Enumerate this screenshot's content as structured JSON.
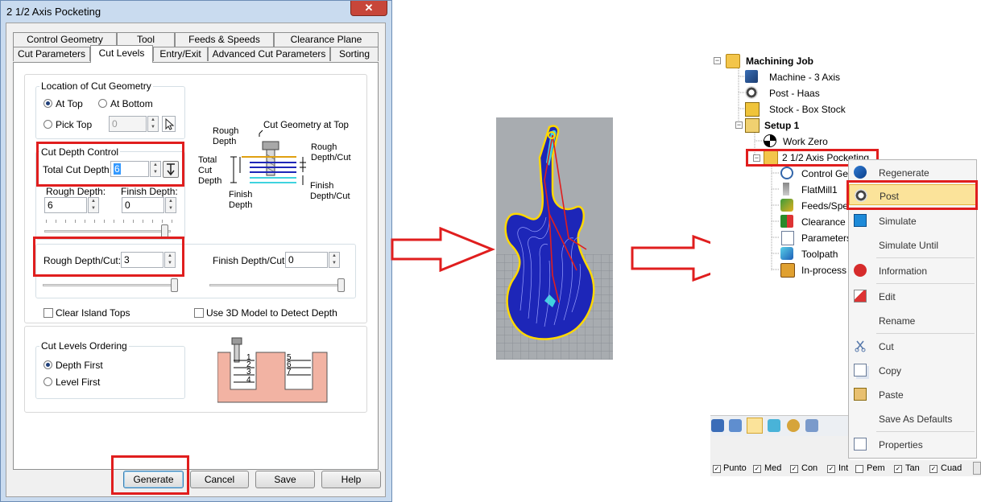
{
  "dialog": {
    "title": "2 1/2 Axis Pocketing",
    "close_glyph": "✕",
    "tabs_back": [
      "Control Geometry",
      "Tool",
      "Feeds & Speeds",
      "Clearance Plane"
    ],
    "tabs_front": [
      "Cut Parameters",
      "Cut Levels",
      "Entry/Exit",
      "Advanced Cut Parameters",
      "Sorting"
    ],
    "active_tab": "Cut Levels",
    "location": {
      "group_label": "Location of Cut Geometry",
      "at_top": "At Top",
      "at_bottom": "At Bottom",
      "pick_top": "Pick Top",
      "pick_top_value": "0",
      "selected": "At Top"
    },
    "depth_control": {
      "group_label": "Cut Depth Control",
      "total_label": "Total Cut Depth:",
      "total_value": "6",
      "rough_label": "Rough Depth:",
      "rough_value": "6",
      "finish_label": "Finish Depth:",
      "finish_value": "0"
    },
    "diagram": {
      "rough_depth": "Rough\nDepth",
      "cut_geom_top": "Cut Geometry at Top",
      "total_cut_depth": "Total\nCut\nDepth",
      "rough_depth_cut": "Rough\nDepth/Cut",
      "finish_depth": "Finish\nDepth",
      "finish_depth_cut": "Finish\nDepth/Cut"
    },
    "per_cut": {
      "rough_label": "Rough Depth/Cut:",
      "rough_value": "3",
      "finish_label": "Finish Depth/Cut:",
      "finish_value": "0"
    },
    "clear_island_tops": "Clear Island Tops",
    "use_3d_model": "Use 3D Model to Detect Depth",
    "ordering": {
      "group_label": "Cut Levels Ordering",
      "depth_first": "Depth First",
      "level_first": "Level First",
      "selected": "Depth First",
      "left_numbers": [
        "1",
        "2",
        "3",
        "4"
      ],
      "right_numbers": [
        "5",
        "6",
        "7"
      ]
    },
    "buttons": {
      "generate": "Generate",
      "cancel": "Cancel",
      "save": "Save",
      "help": "Help"
    }
  },
  "tree": {
    "root": "Machining Job",
    "machine": "Machine - 3 Axis",
    "post": "Post - Haas",
    "stock": "Stock - Box Stock",
    "setup": "Setup 1",
    "work_zero": "Work Zero",
    "operation": "2 1/2 Axis Pocketing",
    "children": [
      "Control Ge",
      "FlatMill1",
      "Feeds/Spee",
      "Clearance",
      "Parameters",
      "Toolpath",
      "In-process"
    ]
  },
  "context_menu": {
    "items": [
      "Regenerate",
      "Post",
      "Simulate",
      "Simulate Until",
      "Information",
      "Edit",
      "Rename",
      "Cut",
      "Copy",
      "Paste",
      "Save As Defaults",
      "Properties"
    ],
    "highlighted": "Post"
  },
  "filter_bar": [
    "Punto",
    "Med",
    "Con",
    "Int",
    "Pem",
    "Tan",
    "Cuad"
  ],
  "filter_checked": [
    true,
    true,
    true,
    true,
    false,
    true,
    true
  ],
  "colors": {
    "annotation_red": "#e01e1e",
    "menu_highlight": "#fbe39a",
    "toolpath_blue": "#1d26b8",
    "outline_yellow": "#ffd800",
    "cyan": "#3fd3df"
  }
}
